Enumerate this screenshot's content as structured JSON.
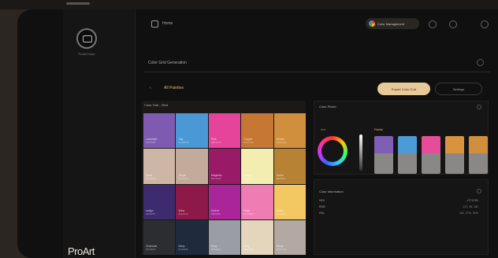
{
  "header": {
    "home_label": "Home",
    "project_label": "Color Management"
  },
  "sidebar": {
    "avatar_label": "ProArt User",
    "logo": "ProArt"
  },
  "bar": {
    "label": "Color Grid Generation"
  },
  "toolbar": {
    "left_label": "",
    "left_caption": "All Palettes",
    "primary_label": "Export Color Grid",
    "secondary_label": "Settings"
  },
  "grid": {
    "caption": "Color Grid - 20x4",
    "swatches": [
      {
        "name": "Lavender",
        "hex": "#7F5FB5",
        "color": "#7e5bb0"
      },
      {
        "name": "Sky",
        "hex": "#4A9BD8",
        "color": "#4a98d6"
      },
      {
        "name": "Pink",
        "hex": "#E64C9A",
        "color": "#e5449a"
      },
      {
        "name": "Copper",
        "hex": "#C87A35",
        "color": "#c57733"
      },
      {
        "name": "Amber",
        "hex": "#D9923E",
        "color": "#d08f3c"
      },
      {
        "name": "Sand",
        "hex": "#CDB8A8",
        "color": "#ceb6a6"
      },
      {
        "name": "Taupe",
        "hex": "#C4AE9F",
        "color": "#c3ab9b"
      },
      {
        "name": "Magenta",
        "hex": "#9C1D6A",
        "color": "#991a66"
      },
      {
        "name": "Cream",
        "hex": "#F3EEB0",
        "color": "#f3edb1"
      },
      {
        "name": "Ochre",
        "hex": "#B98532",
        "color": "#b78233"
      },
      {
        "name": "Indigo",
        "hex": "#3D2870",
        "color": "#3d2a6f"
      },
      {
        "name": "Wine",
        "hex": "#8E1A48",
        "color": "#8c1948"
      },
      {
        "name": "Orchid",
        "hex": "#B0289F",
        "color": "#aa2599"
      },
      {
        "name": "Rose",
        "hex": "#F07DB5",
        "color": "#ef7cb3"
      },
      {
        "name": "Butter",
        "hex": "#F5CB66",
        "color": "#f3c863"
      },
      {
        "name": "Charcoal",
        "hex": "#2C2E33",
        "color": "#2b2d31"
      },
      {
        "name": "Navy",
        "hex": "#1F2B3F",
        "color": "#1f2a3d"
      },
      {
        "name": "Gray",
        "hex": "#9A9EA4",
        "color": "#9a9da3"
      },
      {
        "name": "Ivory",
        "hex": "#E4D6BE",
        "color": "#e4d5bd"
      },
      {
        "name": "Stone",
        "hex": "#B5AAA3",
        "color": "#b3a8a2"
      }
    ]
  },
  "picker": {
    "title": "Color Picker",
    "wheel_label": "Hue",
    "palette_label": "Palette",
    "chips": [
      {
        "top": "#7f5fb5",
        "label": "A"
      },
      {
        "top": "#4a9bd8",
        "label": "B"
      },
      {
        "top": "#e64c9a",
        "label": "C"
      },
      {
        "top": "#d9923e",
        "label": "D"
      },
      {
        "top": "#d08f3c",
        "label": "E"
      }
    ]
  },
  "info": {
    "title": "Color Information",
    "rows": [
      {
        "k": "HEX",
        "v": "#7F5FB5"
      },
      {
        "k": "RGB",
        "v": "127, 95, 181"
      },
      {
        "k": "HSL",
        "v": "262, 37%, 54%"
      }
    ]
  }
}
